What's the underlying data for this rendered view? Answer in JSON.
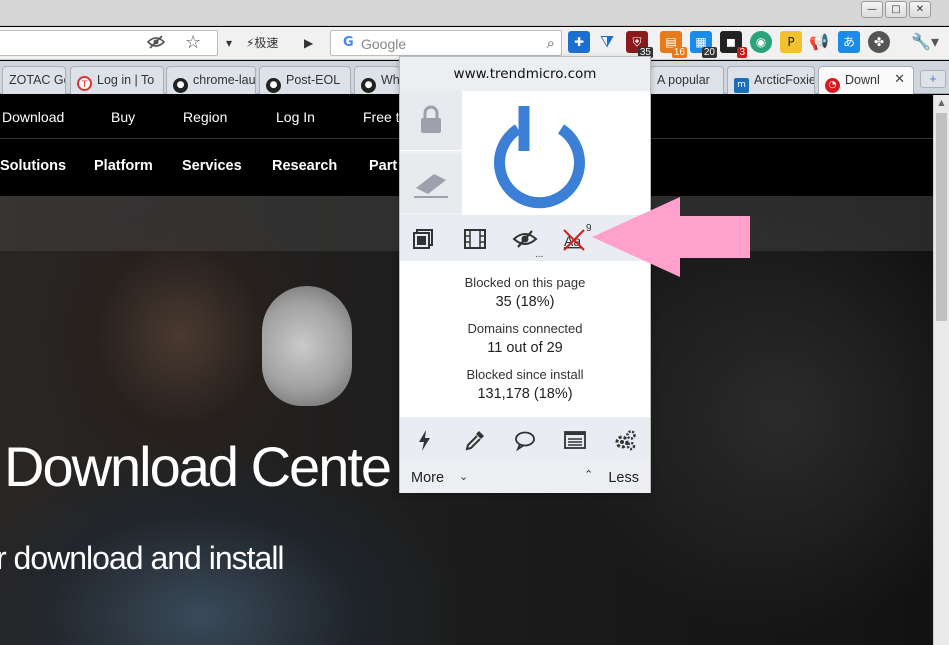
{
  "window": {
    "controls": [
      "—",
      "□",
      "✕"
    ]
  },
  "toolbar": {
    "mode_button": "⚡极速",
    "search_placeholder": "Google",
    "extensions": [
      {
        "name": "ublock",
        "badge": "35",
        "color": "#8b1a1a",
        "badge_color": "#333"
      },
      {
        "name": "ext-16",
        "badge": "16",
        "color": "#e87a1a",
        "badge_color": "#e87a1a"
      },
      {
        "name": "ext-20",
        "badge": "20",
        "color": "#1a8be8",
        "badge_color": "#333"
      },
      {
        "name": "ext-3",
        "badge": "3",
        "color": "#222",
        "badge_color": "#d01818"
      }
    ]
  },
  "tabs": [
    {
      "label": "ZOTAC Ge"
    },
    {
      "label": "Log in | To"
    },
    {
      "label": "chrome-lau"
    },
    {
      "label": "Post-EOL"
    },
    {
      "label": "Wh"
    },
    {
      "label": "A popular"
    },
    {
      "label": "ArcticFoxie"
    },
    {
      "label": "Downl",
      "active": true
    }
  ],
  "page": {
    "topnav": [
      "Download",
      "Buy",
      "Region",
      "Log In",
      "Free t"
    ],
    "mainnav": [
      "Solutions",
      "Platform",
      "Services",
      "Research",
      "Part"
    ],
    "hero_title": "Download Cente",
    "hero_subtitle": "r download and install"
  },
  "popup": {
    "hostname": "www.trendmicro.com",
    "power_color": "#3c7fd6",
    "tools_font_badge": "9",
    "tools_more": "...",
    "stats": [
      {
        "label": "Blocked on this page",
        "value": "35 (18%)"
      },
      {
        "label": "Domains connected",
        "value": "11 out of 29"
      },
      {
        "label": "Blocked since install",
        "value": "131,178 (18%)"
      }
    ],
    "more_label": "More",
    "less_label": "Less"
  },
  "annotation": {
    "arrow_color": "#ffa0cd"
  }
}
